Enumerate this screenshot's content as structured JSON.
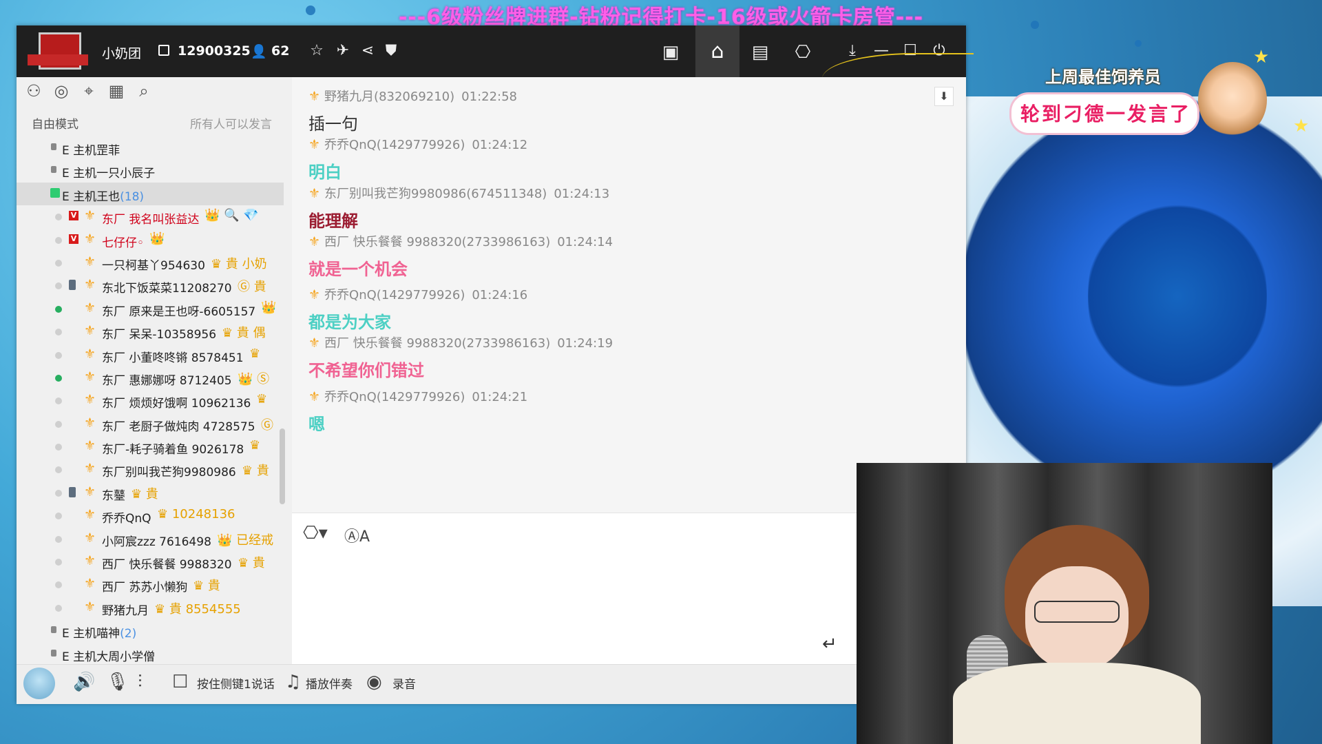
{
  "banner": "---6级粉丝牌进群-钻粉记得打卡-16级或火箭卡房管---",
  "window": {
    "room_name": "小奶团",
    "room_id": "12900325",
    "online_count": "62",
    "toolbar_icons": [
      "star-icon",
      "plane-icon",
      "share-icon",
      "shield-icon",
      "video-icon",
      "home-icon",
      "list-icon",
      "gamepad-icon",
      "minimize-to-tray-icon",
      "minimize-icon",
      "maximize-icon",
      "power-icon"
    ]
  },
  "left_panel": {
    "tools": [
      "user-icon",
      "chat-icon",
      "location-icon",
      "notes-icon",
      "search-icon"
    ],
    "mode_label": "自由模式",
    "mode_note": "所有人可以发言",
    "channels_top": [
      {
        "prefix": "E",
        "name": "主机罡菲",
        "count": ""
      },
      {
        "prefix": "E",
        "name": "主机一只小辰子",
        "count": ""
      },
      {
        "prefix": "E",
        "name": "主机王也",
        "count": "(18)"
      }
    ],
    "users": [
      {
        "name": "东厂 我名叫张益达",
        "extra": "👑 🔍 💎",
        "red": true,
        "v": true,
        "online": false
      },
      {
        "name": "七仔仔◦",
        "extra": "👑",
        "red": true,
        "v": true,
        "online": false
      },
      {
        "name": "一只柯基丫954630",
        "extra": "♛ 貴 小奶",
        "red": false,
        "v": false,
        "online": false
      },
      {
        "name": "东北下饭菜菜11208270",
        "extra": "Ⓖ 貴",
        "red": false,
        "v": false,
        "phone": true,
        "online": false
      },
      {
        "name": "东厂 原来是王也呀-6605157",
        "extra": "👑",
        "red": false,
        "v": false,
        "online": true
      },
      {
        "name": "东厂 呆呆-10358956",
        "extra": "♛ 貴 偶",
        "red": false,
        "v": false,
        "online": false
      },
      {
        "name": "东厂 小董咚咚锵 8578451",
        "extra": "♛",
        "red": false,
        "v": false,
        "online": false
      },
      {
        "name": "东厂 惠娜娜呀 8712405",
        "extra": "👑 Ⓢ",
        "red": false,
        "v": false,
        "online": true
      },
      {
        "name": "东厂 烦烦好饿啊 10962136",
        "extra": "♛",
        "red": false,
        "v": false,
        "online": false
      },
      {
        "name": "东厂 老厨子做炖肉 4728575",
        "extra": "Ⓖ",
        "red": false,
        "v": false,
        "online": false
      },
      {
        "name": "东厂-耗子骑着鱼 9026178",
        "extra": "♛",
        "red": false,
        "v": false,
        "online": false
      },
      {
        "name": "东厂别叫我芒狗9980986",
        "extra": "♛ 貴",
        "red": false,
        "v": false,
        "online": false
      },
      {
        "name": "东鼞",
        "extra": "♛ 貴",
        "red": false,
        "v": false,
        "phone": true,
        "online": false
      },
      {
        "name": "乔乔QnQ",
        "extra": "♛ 10248136",
        "red": false,
        "v": false,
        "online": false
      },
      {
        "name": "小阿宸zzz 7616498",
        "extra": "👑 已经戒",
        "red": false,
        "v": false,
        "online": false
      },
      {
        "name": "西厂 快乐餐餐 9988320",
        "extra": "♛ 貴",
        "red": false,
        "v": false,
        "online": false
      },
      {
        "name": "西厂 苏苏小懒狗",
        "extra": "♛ 貴",
        "red": false,
        "v": false,
        "online": false
      },
      {
        "name": "野猪九月",
        "extra": "♛ 貴 8554555",
        "red": false,
        "v": false,
        "online": false
      }
    ],
    "channels_bottom": [
      {
        "prefix": "E",
        "name": "主机喵神",
        "count": "(2)"
      },
      {
        "prefix": "E",
        "name": "主机大周小学僧",
        "count": ""
      }
    ]
  },
  "chat": {
    "messages": [
      {
        "sender": "野猪九月(832069210)",
        "time": "01:22:58",
        "text": "插一句",
        "color": "#333333",
        "bold": false
      },
      {
        "sender": "乔乔QnQ(1429779926)",
        "time": "01:24:12",
        "text": "明白",
        "color": "#4dd0c4",
        "bold": true
      },
      {
        "sender": "东厂别叫我芒狗9980986(674511348)",
        "time": "01:24:13",
        "text": "能理解",
        "color": "#9b1c31",
        "bold": true
      },
      {
        "sender": "西厂 快乐餐餐 9988320(2733986163)",
        "time": "01:24:14",
        "text": "就是一个机会",
        "color": "#f06292",
        "bold": true
      },
      {
        "sender": "乔乔QnQ(1429779926)",
        "time": "01:24:16",
        "text": "都是为大家",
        "color": "#4dd0c4",
        "bold": true
      },
      {
        "sender": "西厂 快乐餐餐 9988320(2733986163)",
        "time": "01:24:19",
        "text": "不希望你们错过",
        "color": "#f06292",
        "bold": true
      },
      {
        "sender": "乔乔QnQ(1429779926)",
        "time": "01:24:21",
        "text": "嗯",
        "color": "#4dd0c4",
        "bold": true
      }
    ]
  },
  "bottom_bar": {
    "push_to_talk": "按住侧键1说话",
    "play_music": "播放伴奏",
    "record": "录音"
  },
  "overlay": {
    "best_title": "上周最佳饲养员",
    "best_name": "轮到刁德一发言了"
  }
}
